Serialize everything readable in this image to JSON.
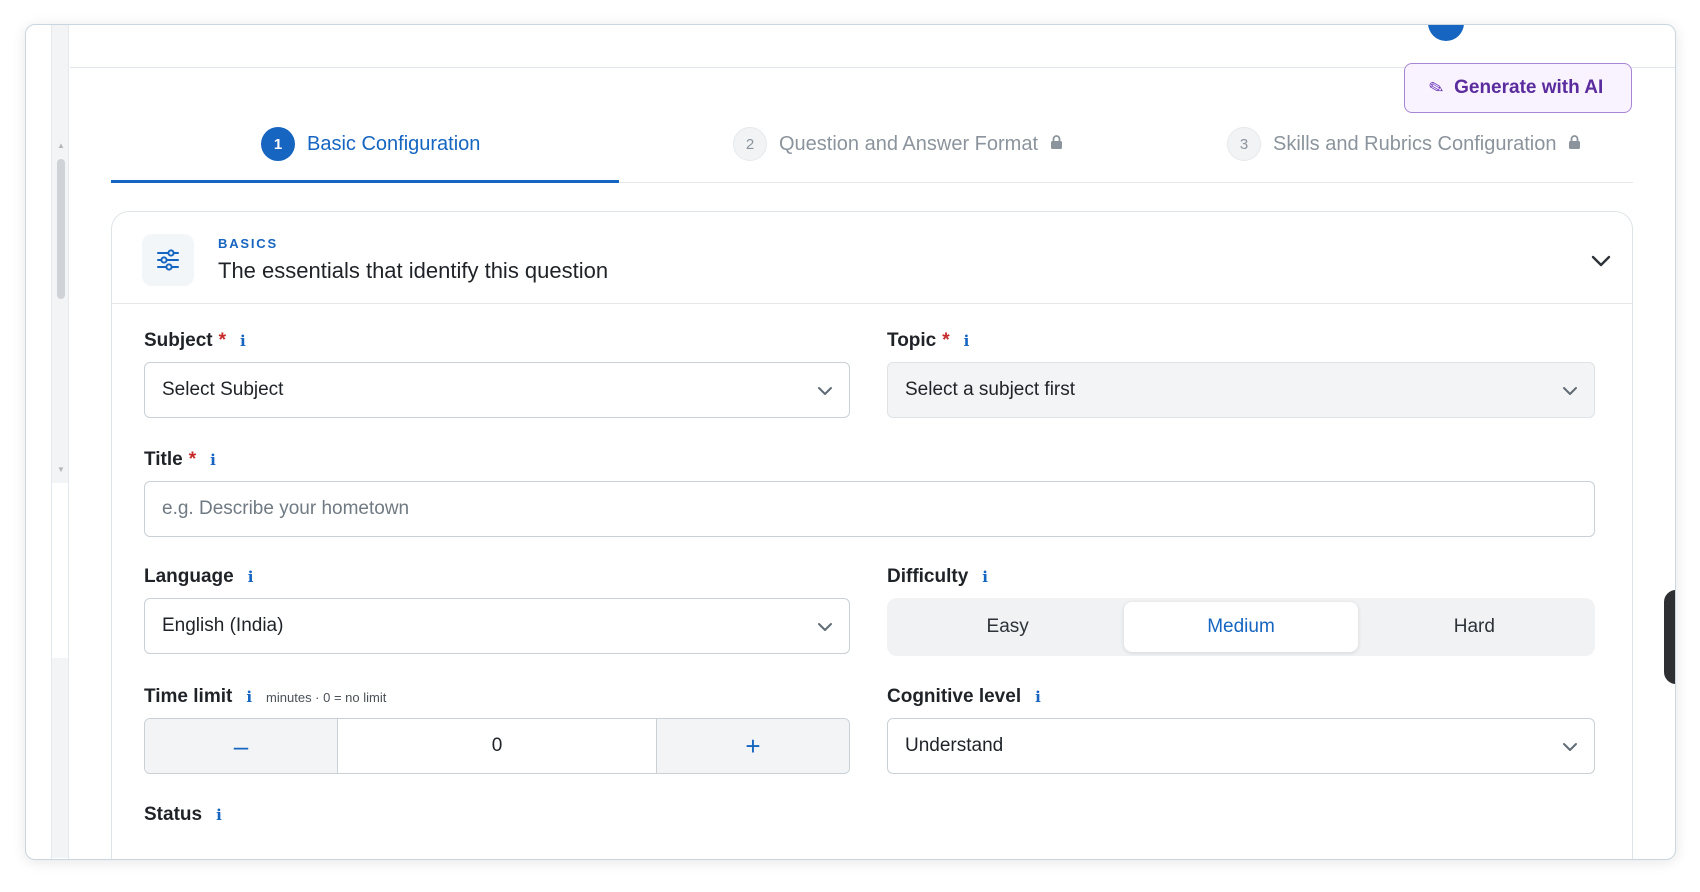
{
  "header": {
    "generate_ai_label": "Generate with AI"
  },
  "steps": [
    {
      "number": "1",
      "label": "Basic Configuration",
      "state": "active"
    },
    {
      "number": "2",
      "label": "Question and Answer Format",
      "state": "locked"
    },
    {
      "number": "3",
      "label": "Skills and Rubrics Configuration",
      "state": "locked"
    }
  ],
  "section": {
    "kicker": "BASICS",
    "title": "The essentials that identify this question"
  },
  "fields": {
    "subject": {
      "label": "Subject",
      "required": "*",
      "info": "i",
      "value": "Select Subject"
    },
    "topic": {
      "label": "Topic",
      "required": "*",
      "info": "i",
      "value": "Select a subject first"
    },
    "title": {
      "label": "Title",
      "required": "*",
      "info": "i",
      "placeholder": "e.g. Describe your hometown"
    },
    "language": {
      "label": "Language",
      "info": "i",
      "value": "English (India)"
    },
    "difficulty": {
      "label": "Difficulty",
      "info": "i",
      "options": [
        "Easy",
        "Medium",
        "Hard"
      ],
      "selected": "Medium"
    },
    "time_limit": {
      "label": "Time limit",
      "info": "i",
      "hint": "minutes · 0 = no limit",
      "value": "0",
      "minus": "–",
      "plus": "+"
    },
    "cognitive_level": {
      "label": "Cognitive level",
      "info": "i",
      "value": "Understand"
    },
    "status": {
      "label": "Status",
      "info": "i"
    }
  },
  "colors": {
    "accent": "#1665c0",
    "ai_border": "#a786d6",
    "ai_text": "#5b2c9e",
    "required": "#c62828"
  }
}
